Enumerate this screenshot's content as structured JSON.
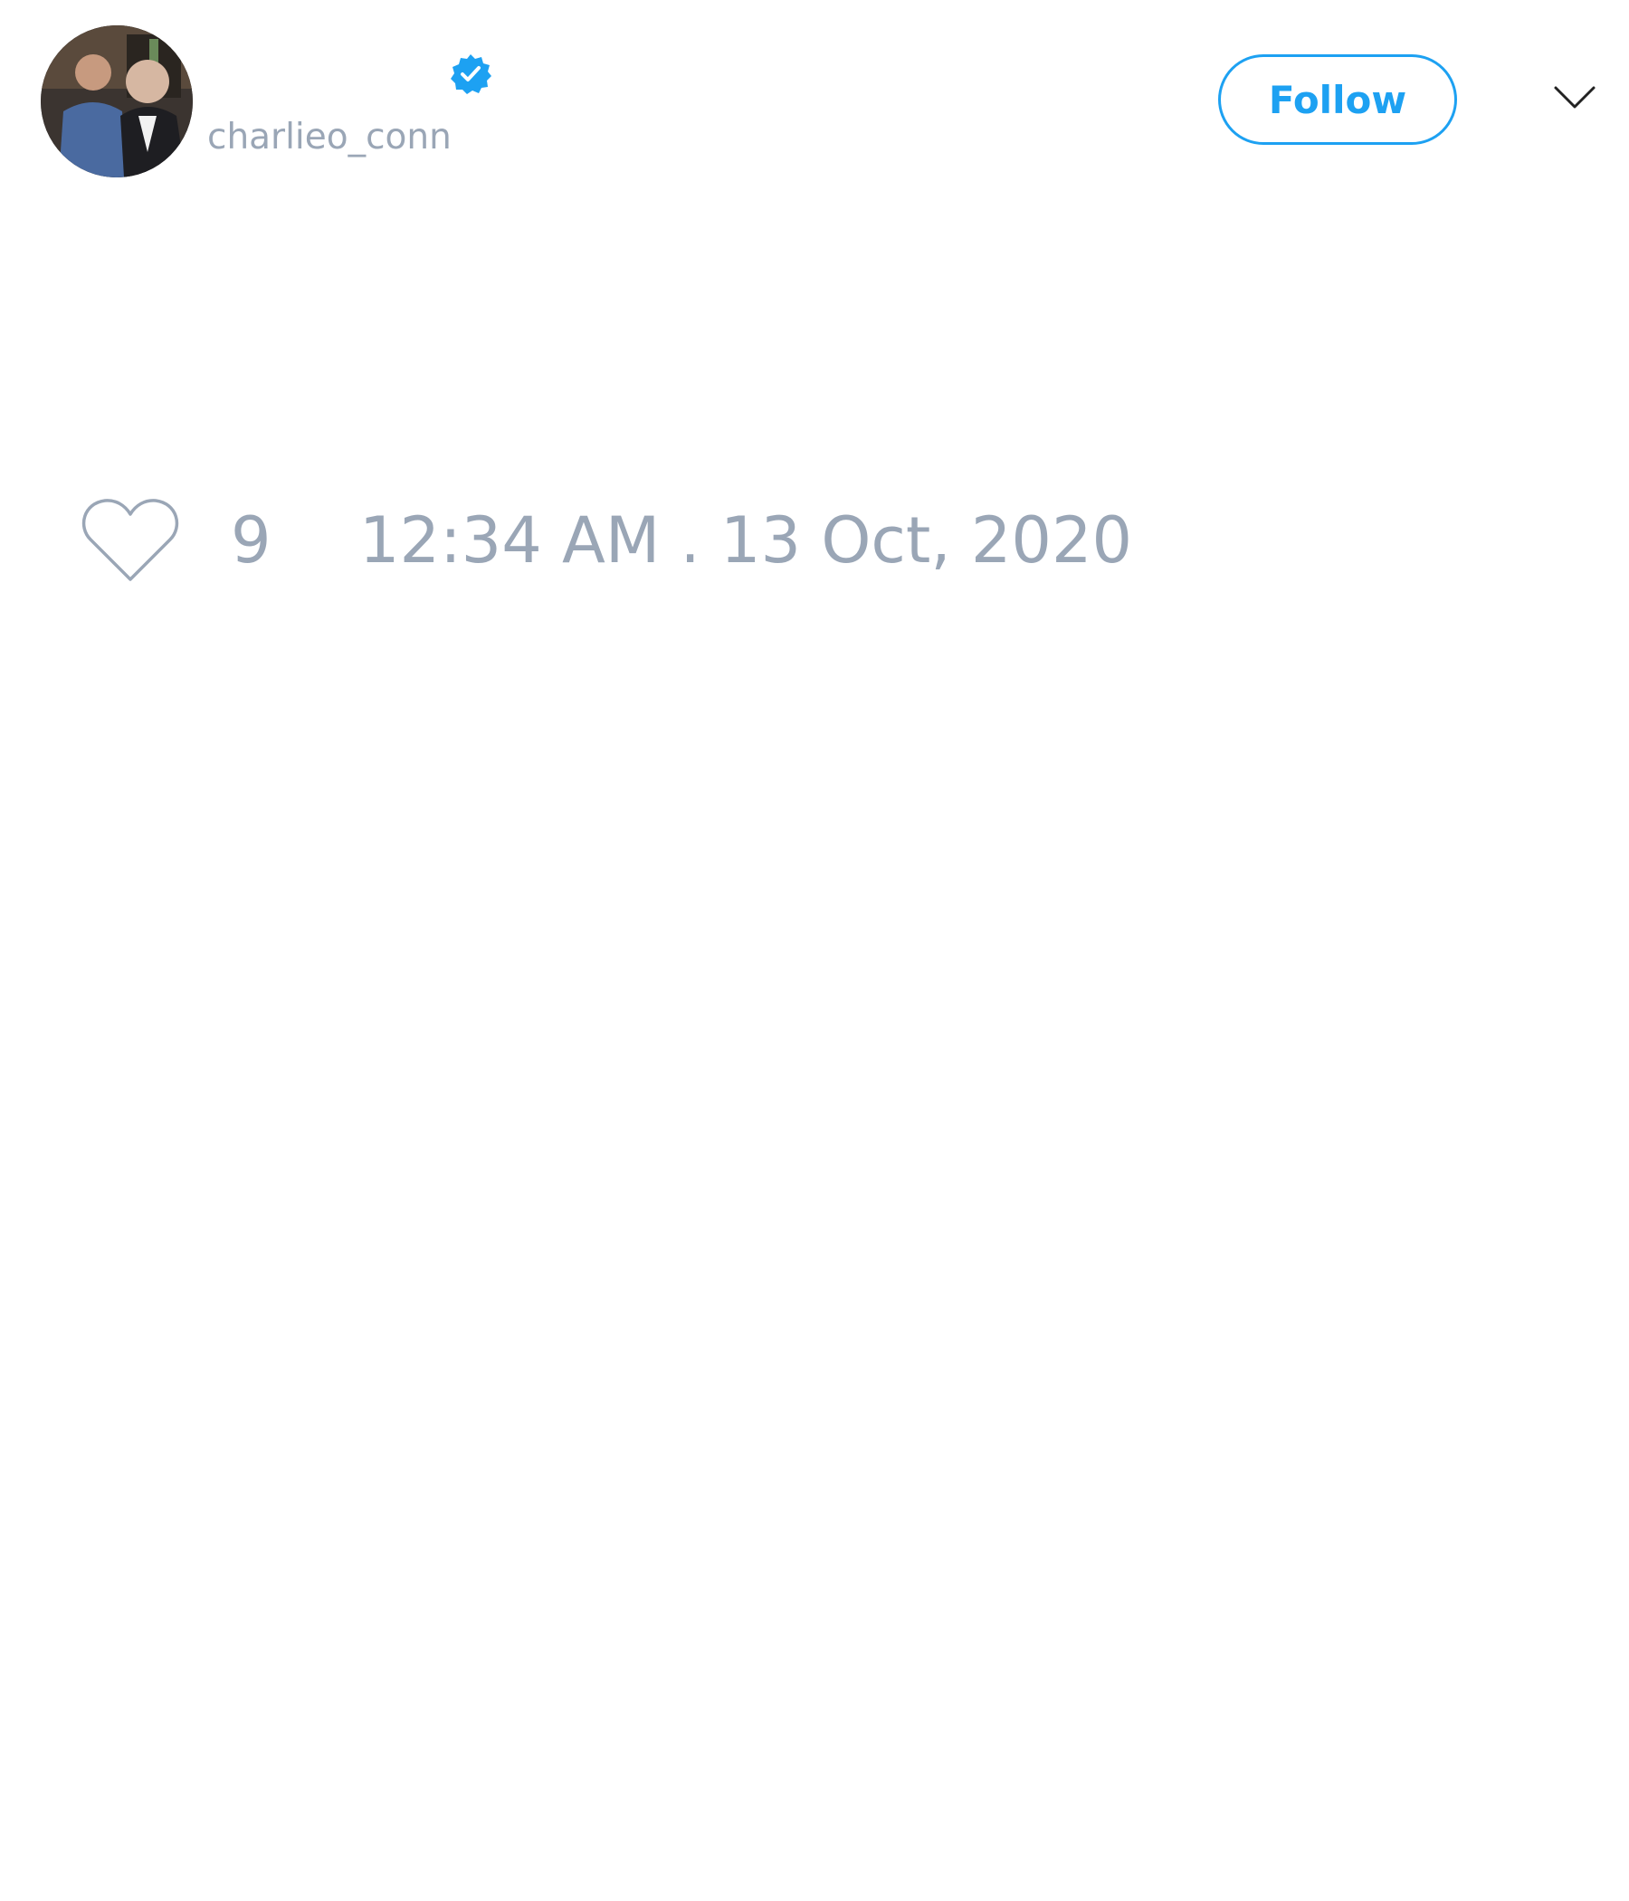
{
  "tweet": {
    "author": {
      "handle": "charlieo_conn",
      "verified": true,
      "avatar": "profile-photo"
    },
    "follow_label": "Follow",
    "menu_icon": "chevron-down-icon",
    "like_icon": "heart-outline-icon",
    "like_count": "9",
    "timestamp": "12:34 AM . 13 Oct, 2020"
  },
  "colors": {
    "accent": "#1da1f2",
    "muted_text": "#9aa6b6",
    "background": "#ffffff"
  }
}
